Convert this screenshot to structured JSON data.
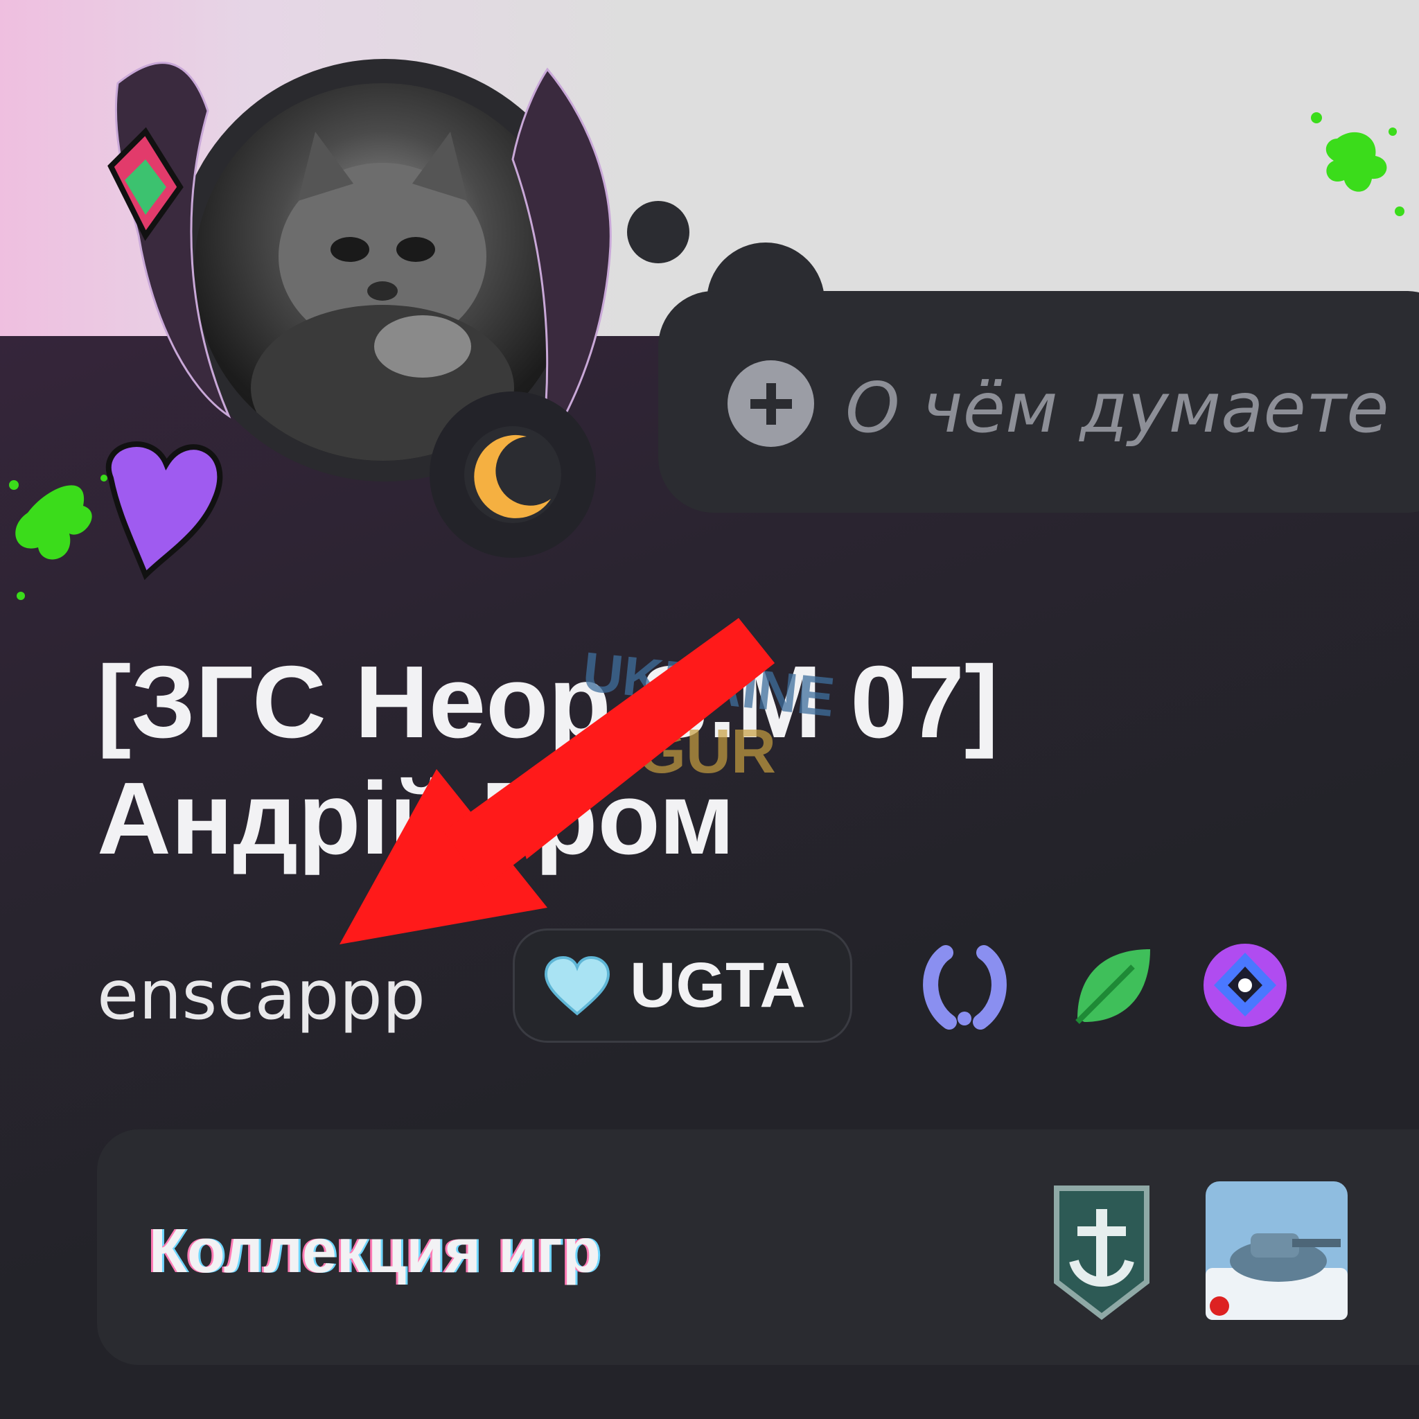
{
  "composer": {
    "placeholder": "О чём думаете"
  },
  "profile": {
    "display_name_line1": "[ЗГС Неор S.М 07]",
    "display_name_line2": "Андрій Гром",
    "username": "enscappp",
    "clan_tag": "UGTA"
  },
  "games": {
    "title": "Коллекция игр"
  },
  "watermark": {
    "line1": "UKRAINE",
    "line2": "GUR"
  },
  "colors": {
    "background": "#232329",
    "banner": "#dedede",
    "card": "#2a2b30",
    "status_moon": "#f5b041",
    "arrow": "#ff1a1a"
  },
  "icons": {
    "status": "moon-icon",
    "composer": "plus-icon",
    "clan": "heart-icon",
    "badges": [
      "laurel-badge-icon",
      "leaf-badge-icon",
      "nitro-badge-icon"
    ],
    "games": [
      "world-of-warships-icon",
      "world-of-tanks-icon"
    ]
  }
}
